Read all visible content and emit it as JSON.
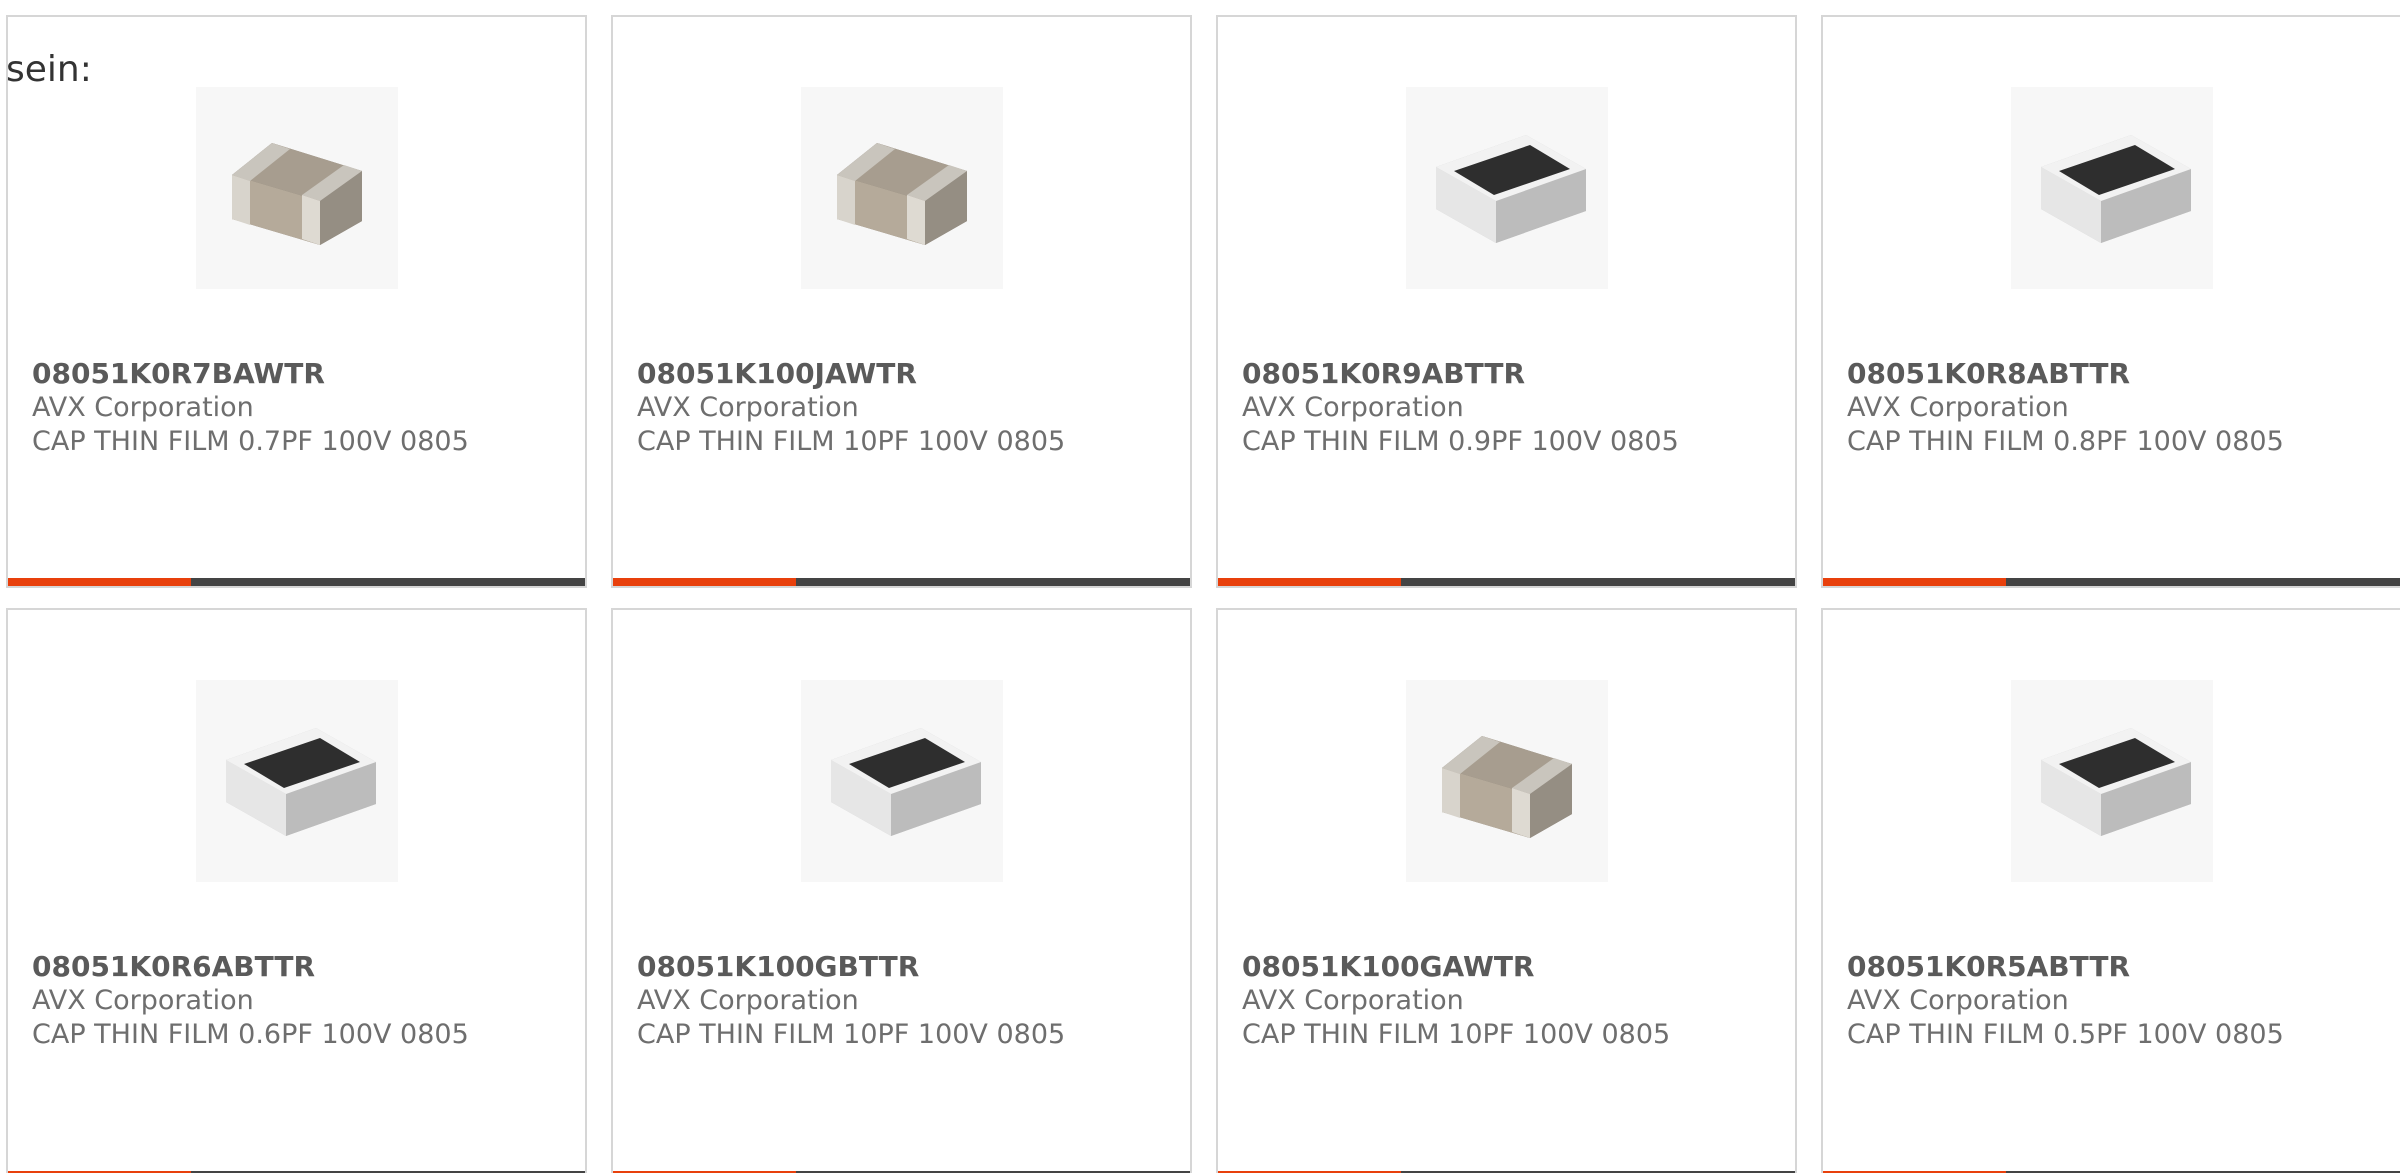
{
  "intro_text": "sein:",
  "colors": {
    "accent": "#e8400c",
    "bar": "#444444",
    "border": "#d6d6d6"
  },
  "products": [
    {
      "part": "08051K0R7BAWTR",
      "manufacturer": "AVX Corporation",
      "description": "CAP THIN FILM 0.7PF 100V 0805",
      "image": "chip-capacitor-ceramic"
    },
    {
      "part": "08051K100JAWTR",
      "manufacturer": "AVX Corporation",
      "description": "CAP THIN FILM 10PF 100V 0805",
      "image": "chip-capacitor-ceramic"
    },
    {
      "part": "08051K0R9ABTTR",
      "manufacturer": "AVX Corporation",
      "description": "CAP THIN FILM 0.9PF 100V 0805",
      "image": "chip-capacitor-thin-film"
    },
    {
      "part": "08051K0R8ABTTR",
      "manufacturer": "AVX Corporation",
      "description": "CAP THIN FILM 0.8PF 100V 0805",
      "image": "chip-capacitor-thin-film"
    },
    {
      "part": "08051K0R6ABTTR",
      "manufacturer": "AVX Corporation",
      "description": "CAP THIN FILM 0.6PF 100V 0805",
      "image": "chip-capacitor-thin-film"
    },
    {
      "part": "08051K100GBTTR",
      "manufacturer": "AVX Corporation",
      "description": "CAP THIN FILM 10PF 100V 0805",
      "image": "chip-capacitor-thin-film"
    },
    {
      "part": "08051K100GAWTR",
      "manufacturer": "AVX Corporation",
      "description": "CAP THIN FILM 10PF 100V 0805",
      "image": "chip-capacitor-ceramic"
    },
    {
      "part": "08051K0R5ABTTR",
      "manufacturer": "AVX Corporation",
      "description": "CAP THIN FILM 0.5PF 100V 0805",
      "image": "chip-capacitor-thin-film"
    }
  ]
}
